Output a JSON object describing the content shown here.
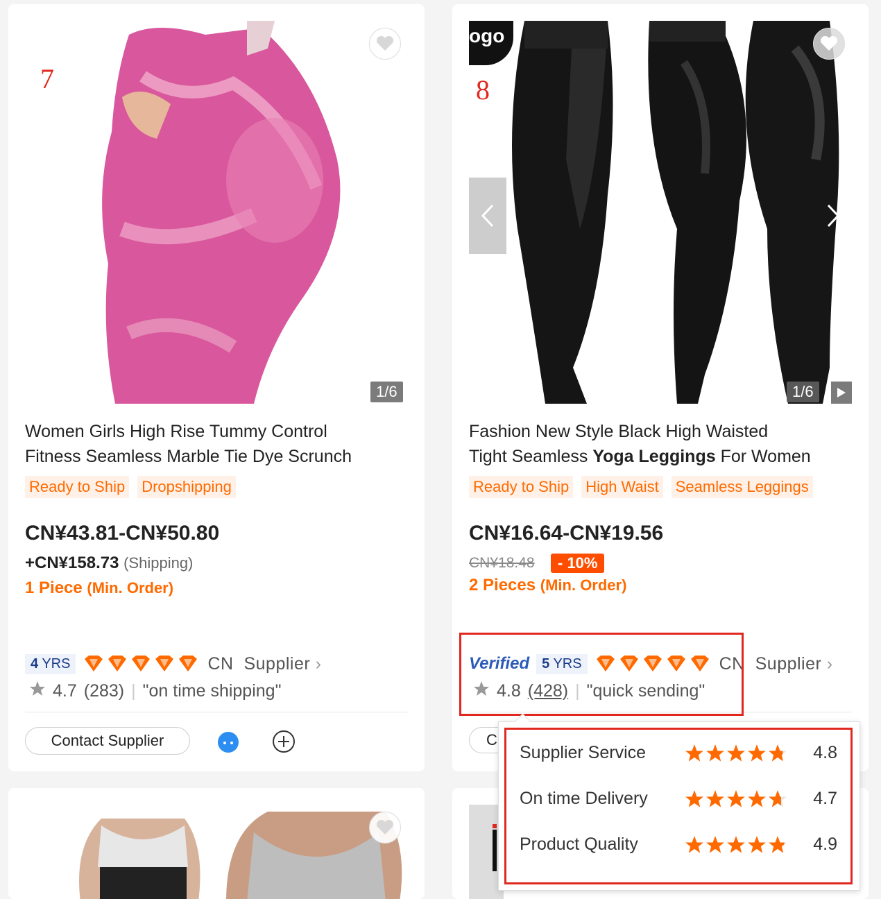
{
  "products": [
    {
      "rank": "7",
      "image_counter": "1/6",
      "title_line1": "Women Girls High Rise Tummy Control",
      "title_line2": "Fitness Seamless Marble Tie Dye Scrunch",
      "tags": [
        "Ready to Ship",
        "Dropshipping"
      ],
      "price_range": "CN¥43.81-CN¥50.80",
      "shipping_price": "+CN¥158.73",
      "shipping_label": "(Shipping)",
      "moq_qty": "1 Piece",
      "moq_label": "(Min. Order)",
      "years_num": "4",
      "years_unit": "YRS",
      "country": "CN",
      "supplier_label": "Supplier",
      "rating": "4.7",
      "reviews": "(283)",
      "review_quote": "\"on time shipping\"",
      "contact_label": "Contact Supplier",
      "diamonds": 5,
      "image_color": "#d9579c"
    },
    {
      "rank": "8",
      "logo_text": "ogo",
      "image_counter": "1/6",
      "title_line1": "Fashion New Style Black High Waisted",
      "title_line2_a": "Tight Seamless ",
      "title_line2_b": "Yoga Leggings",
      "title_line2_c": " For Women",
      "tags": [
        "Ready to Ship",
        "High Waist",
        "Seamless Leggings"
      ],
      "price_range": "CN¥16.64-CN¥19.56",
      "original_price": "CN¥18.48",
      "discount": "- 10%",
      "moq_qty": "2 Pieces",
      "moq_label": "(Min. Order)",
      "verified_label": "Verified",
      "years_num": "5",
      "years_unit": "YRS",
      "country": "CN",
      "supplier_label": "Supplier",
      "rating": "4.8",
      "reviews": "(428)",
      "review_quote": "\"quick sending\"",
      "diamonds": 5,
      "image_color": "#141414"
    }
  ],
  "rating_popup": [
    {
      "label": "Supplier Service",
      "value": "4.8",
      "stars": 4.8
    },
    {
      "label": "On time Delivery",
      "value": "4.7",
      "stars": 4.7
    },
    {
      "label": "Product Quality",
      "value": "4.9",
      "stars": 4.9
    }
  ],
  "colors": {
    "accent": "#ff6a00",
    "highlight": "#e0281f",
    "verified": "#2b5bb8",
    "star": "#ff6a00"
  }
}
